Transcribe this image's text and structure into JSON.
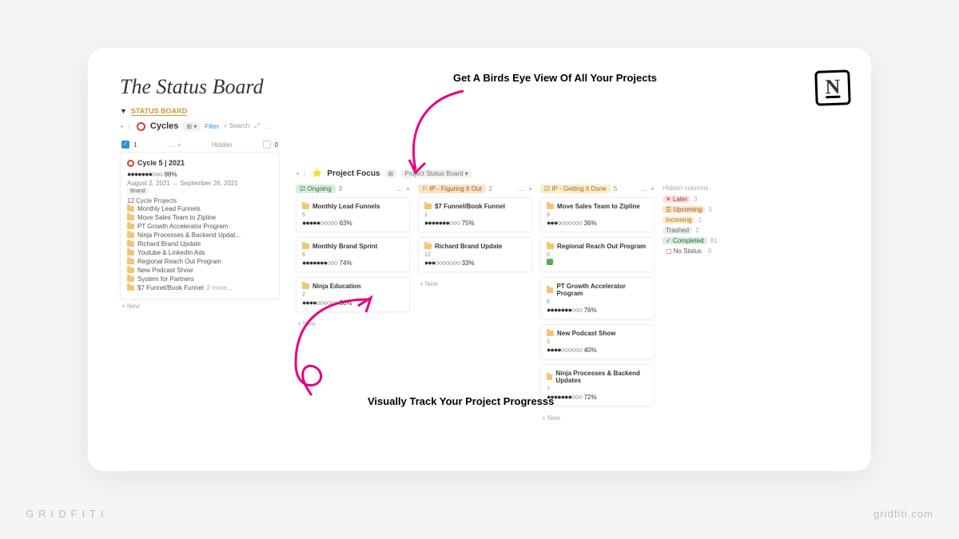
{
  "branding": {
    "left": "GRIDFITI",
    "right": "gridfiti.com"
  },
  "annotations": {
    "top": "Get A Birds Eye View Of All Your Projects",
    "bottom": "Visually Track Your Project Progresss"
  },
  "header": {
    "title": "The Status Board",
    "toggle_label": "STATUS BOARD"
  },
  "cycles_db": {
    "name": "Cycles",
    "view_type": "⊞ ▾",
    "filter": "Filter",
    "search": "Search",
    "hidden_label": "Hidden",
    "checked_count": "1",
    "unchecked_count": "0",
    "new": "+  New",
    "card": {
      "title": "Cycle 5 | 2021",
      "progress_dots": "●●●●●●●○○○",
      "progress_pct": "88%",
      "dates": "August 2, 2021 → September 26, 2021",
      "brand_tag": "Brand",
      "count_label": "12 Cycle Projects",
      "projects": [
        "Monthly Lead Funnels",
        "Move Sales Team to Zipline",
        "PT Growth Accelerator Program",
        "Ninja Processes & Backend Updat...",
        "Richard Brand Update",
        "Youtube & LinkedIn Ads",
        "Regional Reach Out Program",
        "New Podcast Show",
        "System for Partners"
      ],
      "more_line": "$7 Funnel/Book Funnel",
      "more_suffix": "2 more..."
    }
  },
  "board": {
    "pf_icon": "⭐",
    "pf_label": "Project Focus",
    "view_icon": "⊞",
    "view_label": "Project Status Board",
    "new": "+  New",
    "hidden_columns_label": "Hidden columns",
    "columns": [
      {
        "key": "ongoing",
        "label": "Ongoing",
        "tag_class": "green",
        "count": "3",
        "icon": "☑",
        "cards": [
          {
            "title": "Monthly Lead Funnels",
            "num": "5",
            "dots": "●●●●●○○○○○",
            "pct": "63%"
          },
          {
            "title": "Monthly Brand Sprint",
            "num": "6",
            "dots": "●●●●●●●○○○",
            "pct": "74%"
          },
          {
            "title": "Ninja Education",
            "num": "2",
            "dots": "●●●●○○○○○○",
            "pct": "50%"
          }
        ]
      },
      {
        "key": "figuring",
        "label": "IP - Figuring It Out",
        "tag_class": "orange",
        "count": "2",
        "icon": "⚐",
        "cards": [
          {
            "title": "$7 Funnel/Book Funnel",
            "num": "1",
            "dots": "●●●●●●●○○○",
            "pct": "75%"
          },
          {
            "title": "Richard Brand Update",
            "num": "12",
            "dots": "●●●○○○○○○○",
            "pct": "33%"
          }
        ]
      },
      {
        "key": "getting",
        "label": "IP - Getting It Done",
        "tag_class": "yellow",
        "count": "5",
        "icon": "☑",
        "cards": [
          {
            "title": "Move Sales Team to Zipline",
            "num": "9",
            "dots": "●●●○○○○○○○",
            "pct": "36%"
          },
          {
            "title": "Regional Reach Out Program",
            "num": "0",
            "check": true
          },
          {
            "title": "PT Growth Accelerator Program",
            "num": "5",
            "dots": "●●●●●●●○○○",
            "pct": "76%"
          },
          {
            "title": "New Podcast Show",
            "num": "3",
            "dots": "●●●●○○○○○○",
            "pct": "40%"
          },
          {
            "title": "Ninja Processes & Backend Updates",
            "num": "7",
            "dots": "●●●●●●●○○○",
            "pct": "72%"
          }
        ]
      }
    ],
    "hidden": [
      {
        "label": "Later",
        "class": "later",
        "icon": "✕",
        "count": "3"
      },
      {
        "label": "Upcoming",
        "class": "upcoming",
        "icon": "☰",
        "count": "0"
      },
      {
        "label": "Incoming",
        "class": "incoming",
        "icon": "",
        "count": "1"
      },
      {
        "label": "Trashed",
        "class": "trashed",
        "icon": "",
        "count": "2"
      },
      {
        "label": "Completed",
        "class": "completed",
        "icon": "✓",
        "count": "81"
      },
      {
        "label": "No Status",
        "class": "nostatus",
        "icon": "▢",
        "count": "0"
      }
    ]
  }
}
